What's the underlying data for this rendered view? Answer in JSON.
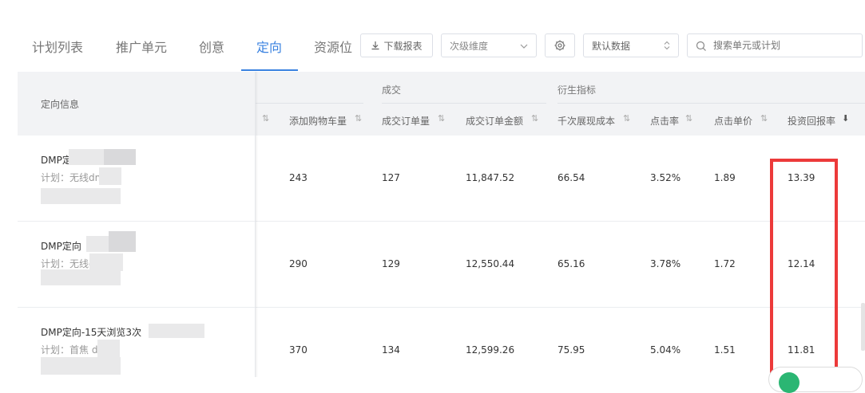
{
  "tabs": [
    {
      "label": "计划列表",
      "active": false
    },
    {
      "label": "推广单元",
      "active": false
    },
    {
      "label": "创意",
      "active": false
    },
    {
      "label": "定向",
      "active": true
    },
    {
      "label": "资源位",
      "active": false
    }
  ],
  "toolbar": {
    "download_label": "下载报表",
    "secondary_dimension_placeholder": "次级维度",
    "default_data_label": "默认数据",
    "search_placeholder": "搜索单元或计划"
  },
  "table": {
    "fixed_header": "定向信息",
    "groups": {
      "deal": "成交",
      "derived": "衍生指标"
    },
    "columns": [
      "添加购物车量",
      "成交订单量",
      "成交订单金额",
      "千次展现成本",
      "点击率",
      "点击单价",
      "投资回报率"
    ],
    "rows": [
      {
        "name": "DMP定",
        "plan": "计划：无线dmp",
        "values": [
          "243",
          "127",
          "11,847.52",
          "66.54",
          "3.52%",
          "1.89",
          "13.39"
        ]
      },
      {
        "name": "DMP定向",
        "plan": "计划：无线dmp",
        "values": [
          "290",
          "129",
          "12,550.44",
          "65.16",
          "3.78%",
          "1.72",
          "12.14"
        ]
      },
      {
        "name": "DMP定向-15天浏览3次",
        "plan": "计划：首焦 dmp",
        "values": [
          "370",
          "134",
          "12,599.26",
          "75.95",
          "5.04%",
          "1.51",
          "11.81"
        ]
      }
    ]
  },
  "colors": {
    "accent": "#3a82e0",
    "highlight": "#ec3a3a"
  }
}
